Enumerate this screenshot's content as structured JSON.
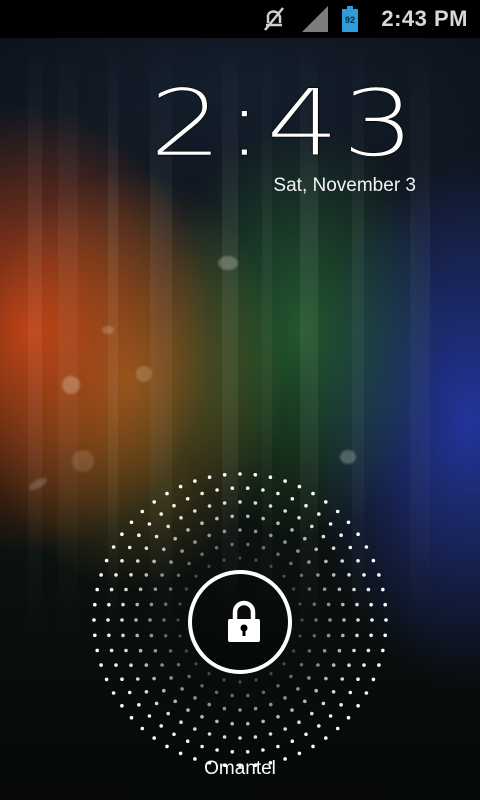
{
  "status_bar": {
    "time": "2:43 PM",
    "battery_level": "92",
    "icons": [
      "mute-icon",
      "signal-icon",
      "battery-icon"
    ],
    "battery_color": "#2f9dd8"
  },
  "lockscreen": {
    "clock": "2:43",
    "date": "Sat, November 3",
    "carrier": "Omantel",
    "unlock_icon": "lock-icon"
  }
}
